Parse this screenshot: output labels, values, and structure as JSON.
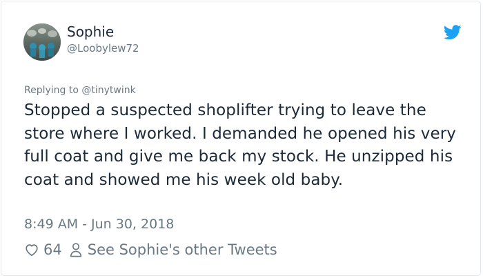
{
  "user": {
    "name": "Sophie",
    "handle": "@Loobylew72"
  },
  "tweet": {
    "reply_context": "Replying to @tinytwink",
    "text": "Stopped a suspected shoplifter trying to leave the store where I worked. I demanded he opened his very full coat and give me back my stock. He unzipped his coat and showed me his week old baby.",
    "timestamp": "8:49 AM - Jun 30, 2018"
  },
  "actions": {
    "like_count": "64",
    "other_tweets_label": "See Sophie's other Tweets"
  },
  "icons": {
    "brand": "twitter-bird-icon",
    "like": "heart-icon",
    "profile": "person-icon"
  },
  "colors": {
    "brand_blue": "#1da1f2",
    "text": "#1c2938",
    "muted": "#697882",
    "border": "#e1e8ed"
  }
}
